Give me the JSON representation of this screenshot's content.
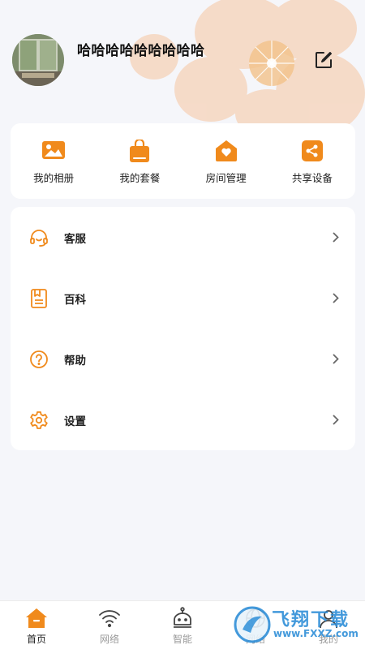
{
  "profile": {
    "username": "哈哈哈哈哈哈哈哈哈",
    "avatar_icon": "avatar-photo",
    "edit_icon": "edit-icon"
  },
  "quick_actions": [
    {
      "label": "我的相册",
      "icon": "image-icon"
    },
    {
      "label": "我的套餐",
      "icon": "shopping-bag-icon"
    },
    {
      "label": "房间管理",
      "icon": "home-heart-icon"
    },
    {
      "label": "共享设备",
      "icon": "share-icon"
    }
  ],
  "menu": [
    {
      "label": "客服",
      "icon": "headset-icon"
    },
    {
      "label": "百科",
      "icon": "book-icon"
    },
    {
      "label": "帮助",
      "icon": "help-icon"
    },
    {
      "label": "设置",
      "icon": "gear-icon"
    }
  ],
  "tabs": [
    {
      "label": "首页",
      "icon": "home-icon",
      "active": true
    },
    {
      "label": "网络",
      "icon": "wifi-icon",
      "active": false
    },
    {
      "label": "智能",
      "icon": "robot-icon",
      "active": false
    },
    {
      "label": "网络",
      "icon": "globe-icon",
      "active": false
    },
    {
      "label": "我的",
      "icon": "user-icon",
      "active": false
    }
  ],
  "watermark": {
    "title": "飞翔下载",
    "url": "www.FXXZ.com"
  },
  "colors": {
    "accent": "#f08a1c",
    "background": "#f5f6fa",
    "card": "#ffffff",
    "watermark": "#2f8fd8"
  }
}
